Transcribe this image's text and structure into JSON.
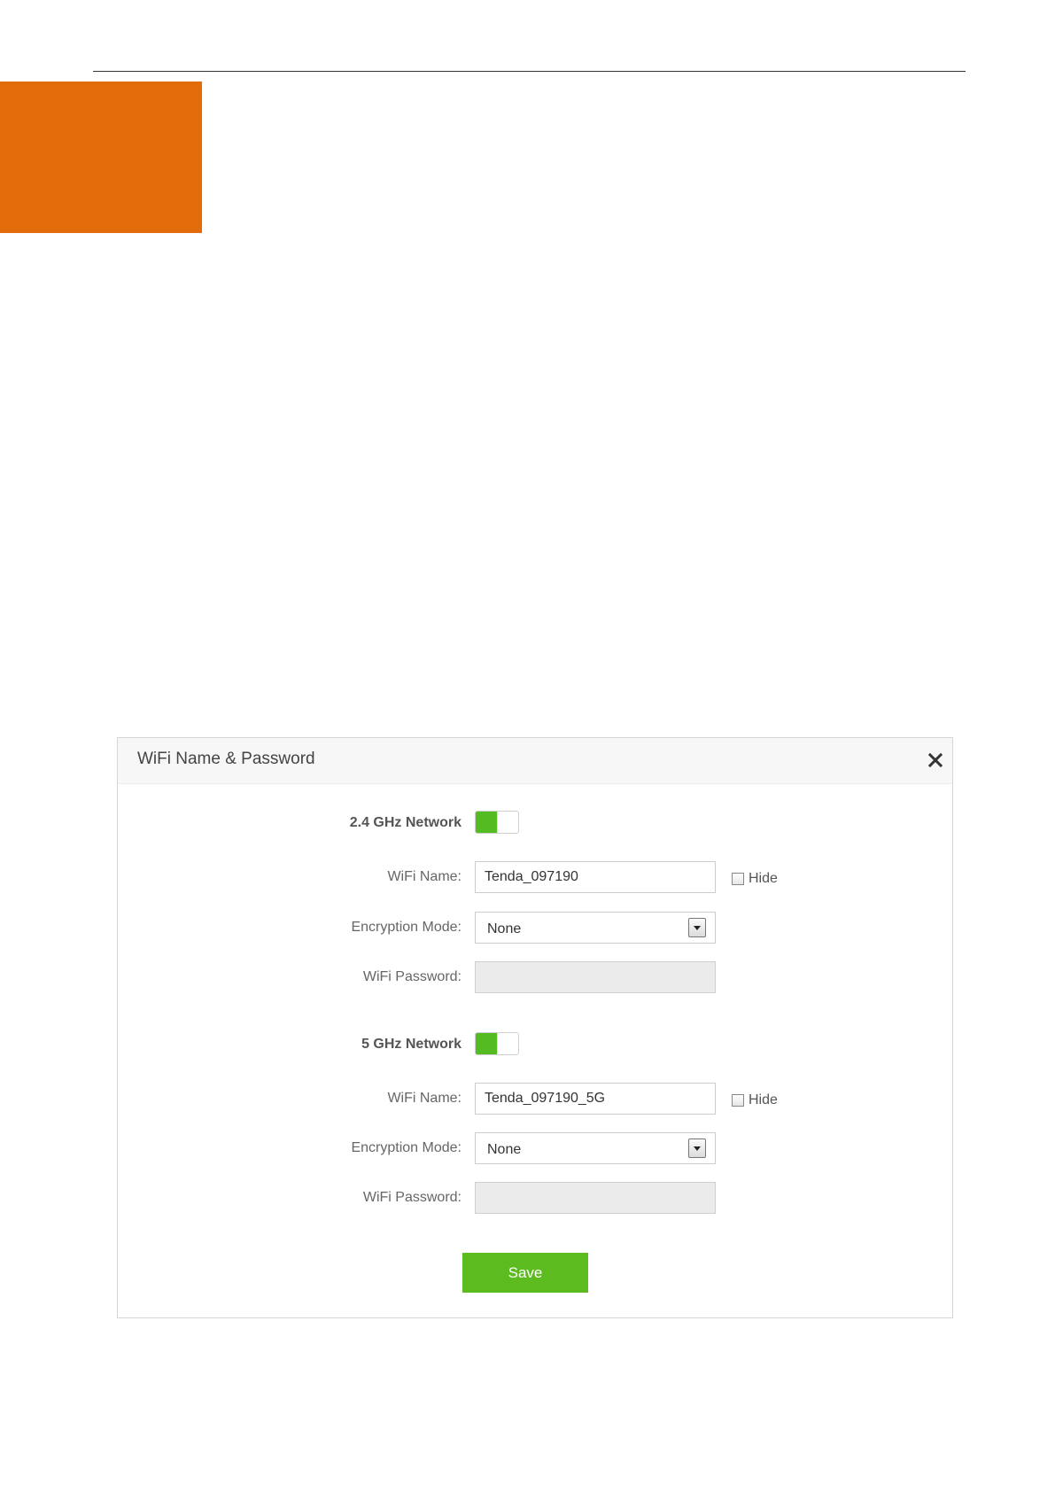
{
  "colors": {
    "orange_block": "#e36c0a",
    "toggle_on": "#55bb22",
    "save_button": "#5cbb1f"
  },
  "dialog": {
    "title": "WiFi Name & Password",
    "close_icon": "close-icon"
  },
  "network_24": {
    "section_label": "2.4 GHz Network",
    "enabled": true,
    "wifi_name_label": "WiFi Name:",
    "wifi_name_value": "Tenda_097190",
    "hide_label": "Hide",
    "hide_checked": false,
    "encryption_label": "Encryption Mode:",
    "encryption_value": "None",
    "password_label": "WiFi Password:",
    "password_value": ""
  },
  "network_5": {
    "section_label": "5 GHz Network",
    "enabled": true,
    "wifi_name_label": "WiFi Name:",
    "wifi_name_value": "Tenda_097190_5G",
    "hide_label": "Hide",
    "hide_checked": false,
    "encryption_label": "Encryption Mode:",
    "encryption_value": "None",
    "password_label": "WiFi Password:",
    "password_value": ""
  },
  "actions": {
    "save_label": "Save"
  }
}
